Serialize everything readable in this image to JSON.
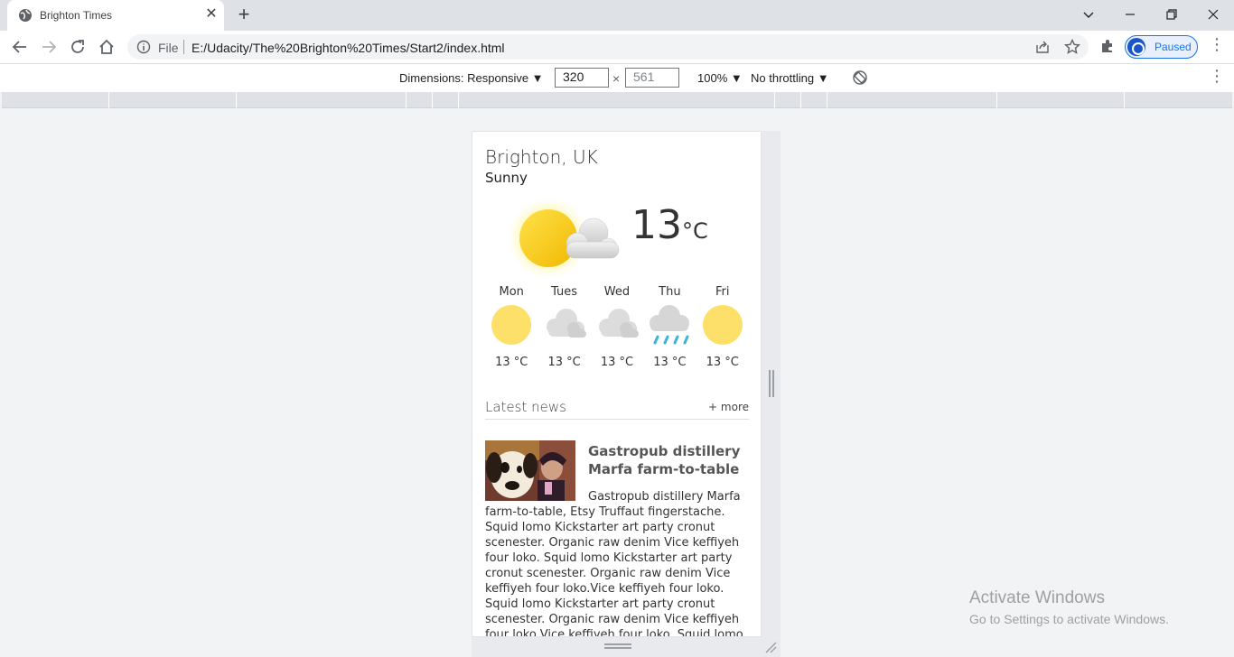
{
  "browser": {
    "tab_title": "Brighton Times",
    "url_scheme": "File",
    "url": "E:/Udacity/The%20Brighton%20Times/Start2/index.html",
    "profile_label": "Paused",
    "accent": "#1a73e8"
  },
  "devtools": {
    "dimensions_label": "Dimensions: Responsive ▼",
    "width": "320",
    "height": "561",
    "zoom": "100% ▼",
    "throttling": "No throttling ▼"
  },
  "weather": {
    "city": "Brighton, UK",
    "condition": "Sunny",
    "temp_value": "13",
    "temp_unit": "°C",
    "days": [
      {
        "name": "Mon",
        "icon": "sun-icon",
        "temp": "13 °C"
      },
      {
        "name": "Tues",
        "icon": "cloud-icon",
        "temp": "13 °C"
      },
      {
        "name": "Wed",
        "icon": "cloud-icon",
        "temp": "13 °C"
      },
      {
        "name": "Thu",
        "icon": "rain-icon",
        "temp": "13 °C"
      },
      {
        "name": "Fri",
        "icon": "sun-icon",
        "temp": "13 °C"
      }
    ]
  },
  "news": {
    "heading": "Latest news",
    "more": "+ more",
    "article_title": "Gastropub distillery Marfa farm-to-table",
    "article_body": "Gastropub distillery Marfa farm-to-table, Etsy Truffaut fingerstache. Squid lomo Kickstarter art party cronut scenester. Organic raw denim Vice keffiyeh four loko. Squid lomo Kickstarter art party cronut scenester. Organic raw denim Vice keffiyeh four loko.Vice keffiyeh four loko. Squid lomo Kickstarter art party cronut scenester. Organic raw denim Vice keffiyeh four loko.Vice keffiyeh four loko. Squid lomo Kickstarter art party cronut scenester."
  },
  "watermark": {
    "line1": "Activate Windows",
    "line2": "Go to Settings to activate Windows."
  }
}
